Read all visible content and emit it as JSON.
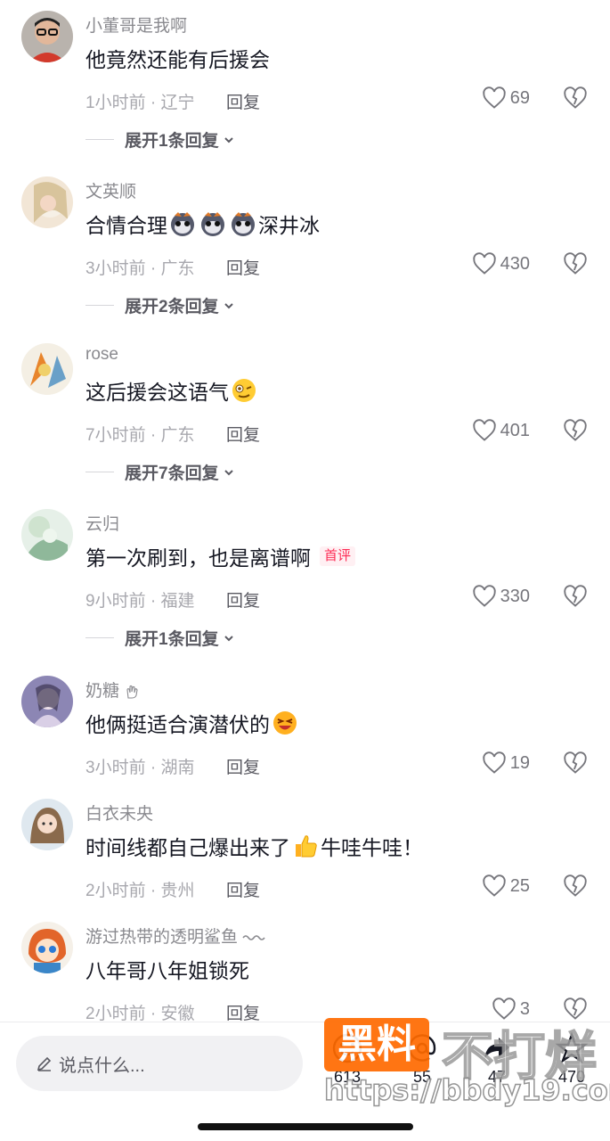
{
  "comments": [
    {
      "user": "小董哥是我啊",
      "text": "他竟然还能有后援会",
      "time": "1小时前",
      "loc": "辽宁",
      "reply": "回复",
      "likes": "69",
      "expand": "展开1条回复"
    },
    {
      "user": "文英顺",
      "text": "合情合理",
      "text2": "深井冰",
      "time": "3小时前",
      "loc": "广东",
      "reply": "回复",
      "likes": "430",
      "expand": "展开2条回复"
    },
    {
      "user": "rose",
      "text": "这后援会这语气",
      "time": "7小时前",
      "loc": "广东",
      "reply": "回复",
      "likes": "401",
      "expand": "展开7条回复"
    },
    {
      "user": "云归",
      "text": "第一次刷到，也是离谱啊",
      "badge": "首评",
      "time": "9小时前",
      "loc": "福建",
      "reply": "回复",
      "likes": "330",
      "expand": "展开1条回复"
    },
    {
      "user": "奶糖",
      "text": "他俩挺适合演潜伏的",
      "time": "3小时前",
      "loc": "湖南",
      "reply": "回复",
      "likes": "19"
    },
    {
      "user": "白衣未央",
      "text": "时间线都自己爆出来了",
      "text2": "牛哇牛哇！",
      "time": "2小时前",
      "loc": "贵州",
      "reply": "回复",
      "likes": "25"
    },
    {
      "user": "游过热带的透明鲨鱼",
      "text": "八年哥八年姐锁死",
      "time": "2小时前",
      "loc": "安徽",
      "reply": "回复",
      "likes": "3"
    }
  ],
  "bottom_bar": {
    "placeholder": "说点什么...",
    "counts": [
      "613",
      "55",
      "47",
      "470"
    ]
  },
  "watermark": {
    "box": "黑料",
    "text": "不打烊",
    "url": "https://bbdy19.com"
  },
  "colors": {
    "accent": "#fe2c55",
    "watermark_orange": "#ff6a00"
  }
}
